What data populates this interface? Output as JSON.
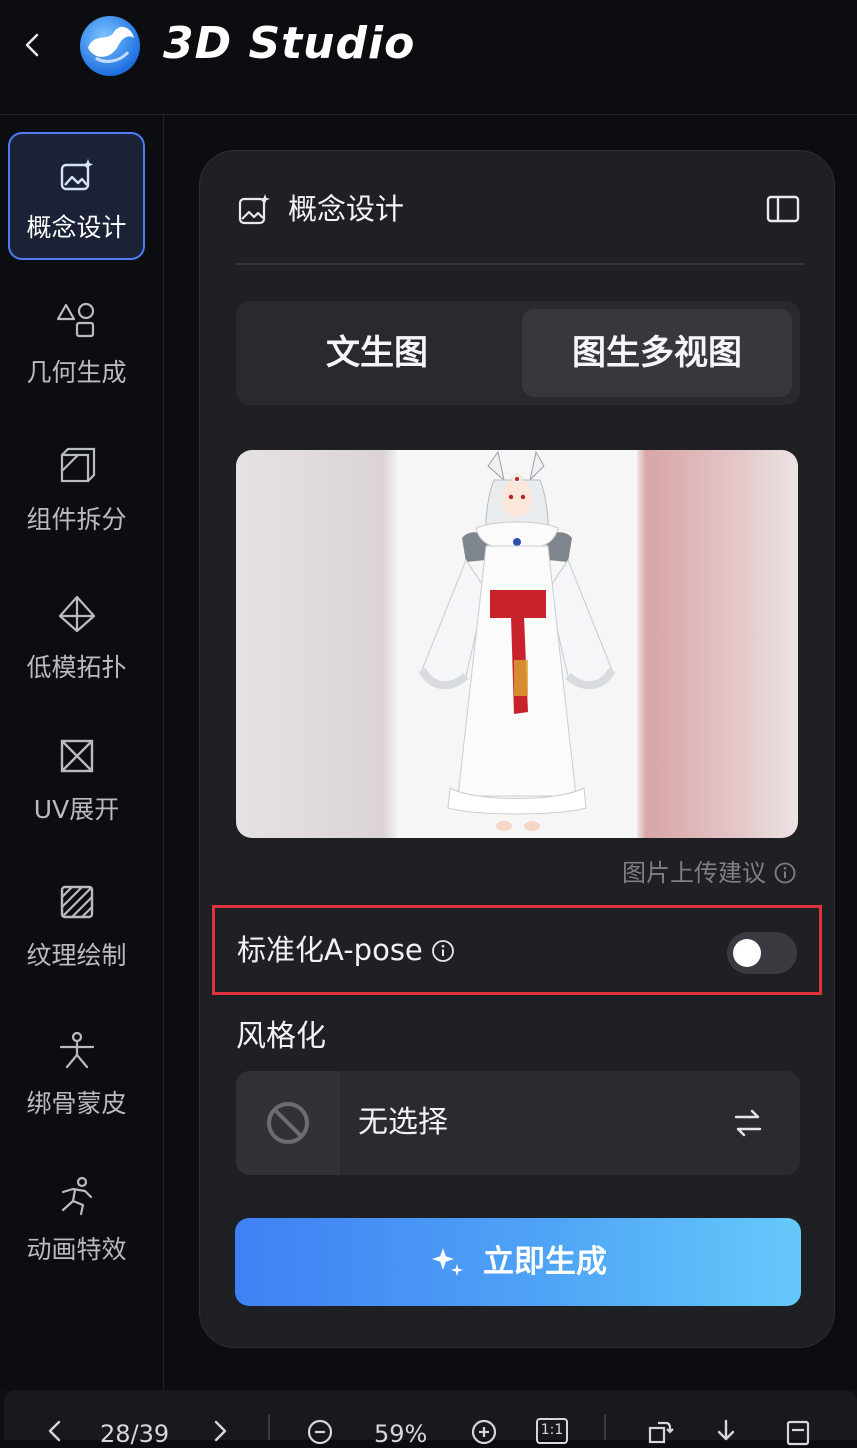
{
  "header": {
    "title": "3D Studio"
  },
  "sidebar": {
    "items": [
      {
        "label": "概念设计",
        "icon": "image-sparkle-icon",
        "active": true
      },
      {
        "label": "几何生成",
        "icon": "shapes-icon",
        "active": false
      },
      {
        "label": "组件拆分",
        "icon": "split-cube-icon",
        "active": false
      },
      {
        "label": "低模拓扑",
        "icon": "pyramid-icon",
        "active": false
      },
      {
        "label": "UV展开",
        "icon": "uv-box-icon",
        "active": false
      },
      {
        "label": "纹理绘制",
        "icon": "texture-icon",
        "active": false
      },
      {
        "label": "绑骨蒙皮",
        "icon": "rig-figure-icon",
        "active": false
      },
      {
        "label": "动画特效",
        "icon": "running-figure-icon",
        "active": false
      }
    ]
  },
  "panel": {
    "title": "概念设计",
    "tabs": [
      {
        "label": "文生图",
        "selected": false
      },
      {
        "label": "图生多视图",
        "selected": true
      }
    ],
    "upload_hint": "图片上传建议",
    "apose": {
      "label": "标准化A-pose",
      "enabled": false
    },
    "style": {
      "label": "风格化",
      "value": "无选择"
    },
    "generate_label": "立即生成"
  },
  "toolbar": {
    "page": "28/39",
    "zoom": "59%",
    "actual_size": "1:1"
  },
  "colors": {
    "accent": "#4f7bf5",
    "highlight_border": "#e0323c",
    "panel_bg": "#1f2024"
  }
}
